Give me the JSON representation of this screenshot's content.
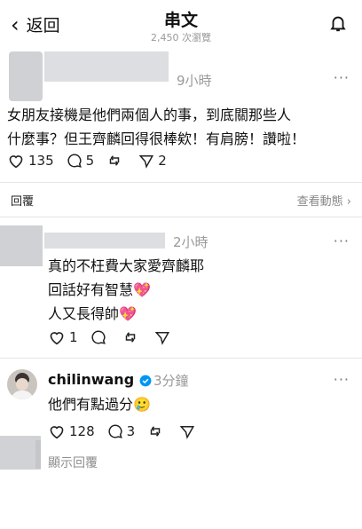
{
  "header": {
    "back_label": "返回",
    "title": "串文",
    "views": "2,450 次瀏覽"
  },
  "post": {
    "time": "9小時",
    "text_line1": "女朋友接機是他們兩個人的事，到底關那些人",
    "text_line2": "什麼事？但王齊麟回得很棒欸！有肩膀！讚啦！",
    "likes": "135",
    "comments": "5",
    "shares": "2"
  },
  "reply_bar": {
    "label": "回覆",
    "view_activity": "查看動態 ›"
  },
  "comment1": {
    "time": "2小時",
    "line1": "真的不枉費大家愛齊麟耶",
    "line2": "回話好有智慧💖",
    "line3": "人又長得帥💖",
    "likes": "1"
  },
  "comment2": {
    "username": "chilinwang",
    "time": "3分鐘",
    "text": "他們有點過分🥲",
    "likes": "128",
    "comments": "3"
  },
  "show_replies": "顯示回覆",
  "colors": {
    "verified": "#0095f6",
    "placeholder_gray": "#d4d6d9"
  }
}
